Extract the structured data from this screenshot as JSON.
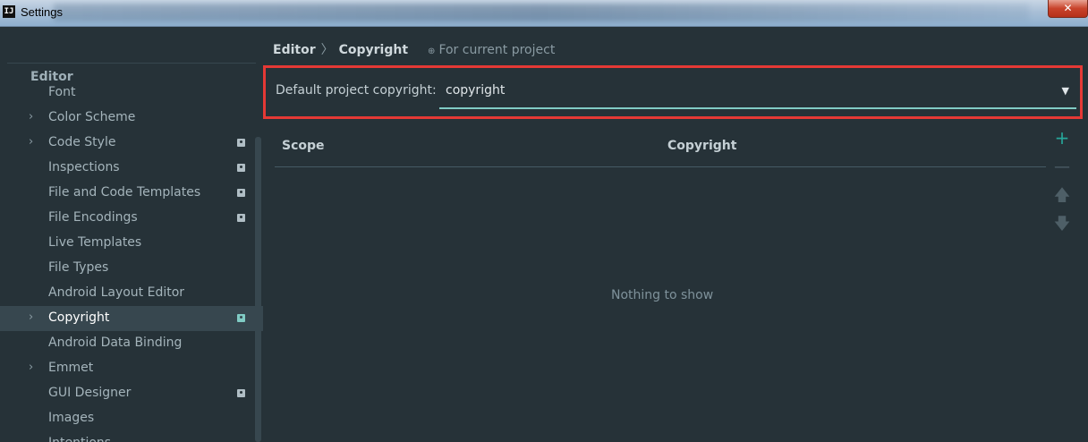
{
  "window": {
    "title": "Settings",
    "app_icon": "IJ",
    "close_glyph": "✕"
  },
  "sidebar": {
    "header": "Editor",
    "items": [
      {
        "label": "Font",
        "has_children": false,
        "project_level": false,
        "selected": false
      },
      {
        "label": "Color Scheme",
        "has_children": true,
        "project_level": false,
        "selected": false
      },
      {
        "label": "Code Style",
        "has_children": true,
        "project_level": true,
        "selected": false
      },
      {
        "label": "Inspections",
        "has_children": false,
        "project_level": true,
        "selected": false
      },
      {
        "label": "File and Code Templates",
        "has_children": false,
        "project_level": true,
        "selected": false
      },
      {
        "label": "File Encodings",
        "has_children": false,
        "project_level": true,
        "selected": false
      },
      {
        "label": "Live Templates",
        "has_children": false,
        "project_level": false,
        "selected": false
      },
      {
        "label": "File Types",
        "has_children": false,
        "project_level": false,
        "selected": false
      },
      {
        "label": "Android Layout Editor",
        "has_children": false,
        "project_level": false,
        "selected": false
      },
      {
        "label": "Copyright",
        "has_children": true,
        "project_level": true,
        "selected": true
      },
      {
        "label": "Android Data Binding",
        "has_children": false,
        "project_level": false,
        "selected": false
      },
      {
        "label": "Emmet",
        "has_children": true,
        "project_level": false,
        "selected": false
      },
      {
        "label": "GUI Designer",
        "has_children": false,
        "project_level": true,
        "selected": false
      },
      {
        "label": "Images",
        "has_children": false,
        "project_level": false,
        "selected": false
      },
      {
        "label": "Intentions",
        "has_children": false,
        "project_level": false,
        "selected": false
      }
    ]
  },
  "breadcrumb": {
    "parent": "Editor",
    "current": "Copyright",
    "scope_note": "For current project"
  },
  "copyright_setting": {
    "label": "Default project copyright:",
    "value": "copyright"
  },
  "table": {
    "columns": [
      "Scope",
      "Copyright"
    ],
    "empty_text": "Nothing to show"
  },
  "toolbar": {
    "add": "+",
    "remove": "—",
    "move_up": "🡅",
    "move_down": "🡇"
  },
  "colors": {
    "accent": "#80cbc4",
    "add": "#26a69a",
    "highlight": "#e53935",
    "background": "#263238"
  }
}
